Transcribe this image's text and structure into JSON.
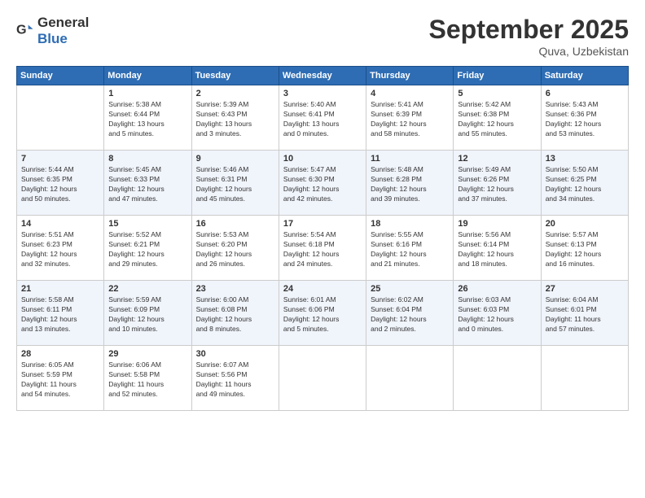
{
  "header": {
    "logo_general": "General",
    "logo_blue": "Blue",
    "month": "September 2025",
    "location": "Quva, Uzbekistan"
  },
  "days_of_week": [
    "Sunday",
    "Monday",
    "Tuesday",
    "Wednesday",
    "Thursday",
    "Friday",
    "Saturday"
  ],
  "weeks": [
    [
      {
        "day": "",
        "text": ""
      },
      {
        "day": "1",
        "text": "Sunrise: 5:38 AM\nSunset: 6:44 PM\nDaylight: 13 hours\nand 5 minutes."
      },
      {
        "day": "2",
        "text": "Sunrise: 5:39 AM\nSunset: 6:43 PM\nDaylight: 13 hours\nand 3 minutes."
      },
      {
        "day": "3",
        "text": "Sunrise: 5:40 AM\nSunset: 6:41 PM\nDaylight: 13 hours\nand 0 minutes."
      },
      {
        "day": "4",
        "text": "Sunrise: 5:41 AM\nSunset: 6:39 PM\nDaylight: 12 hours\nand 58 minutes."
      },
      {
        "day": "5",
        "text": "Sunrise: 5:42 AM\nSunset: 6:38 PM\nDaylight: 12 hours\nand 55 minutes."
      },
      {
        "day": "6",
        "text": "Sunrise: 5:43 AM\nSunset: 6:36 PM\nDaylight: 12 hours\nand 53 minutes."
      }
    ],
    [
      {
        "day": "7",
        "text": "Sunrise: 5:44 AM\nSunset: 6:35 PM\nDaylight: 12 hours\nand 50 minutes."
      },
      {
        "day": "8",
        "text": "Sunrise: 5:45 AM\nSunset: 6:33 PM\nDaylight: 12 hours\nand 47 minutes."
      },
      {
        "day": "9",
        "text": "Sunrise: 5:46 AM\nSunset: 6:31 PM\nDaylight: 12 hours\nand 45 minutes."
      },
      {
        "day": "10",
        "text": "Sunrise: 5:47 AM\nSunset: 6:30 PM\nDaylight: 12 hours\nand 42 minutes."
      },
      {
        "day": "11",
        "text": "Sunrise: 5:48 AM\nSunset: 6:28 PM\nDaylight: 12 hours\nand 39 minutes."
      },
      {
        "day": "12",
        "text": "Sunrise: 5:49 AM\nSunset: 6:26 PM\nDaylight: 12 hours\nand 37 minutes."
      },
      {
        "day": "13",
        "text": "Sunrise: 5:50 AM\nSunset: 6:25 PM\nDaylight: 12 hours\nand 34 minutes."
      }
    ],
    [
      {
        "day": "14",
        "text": "Sunrise: 5:51 AM\nSunset: 6:23 PM\nDaylight: 12 hours\nand 32 minutes."
      },
      {
        "day": "15",
        "text": "Sunrise: 5:52 AM\nSunset: 6:21 PM\nDaylight: 12 hours\nand 29 minutes."
      },
      {
        "day": "16",
        "text": "Sunrise: 5:53 AM\nSunset: 6:20 PM\nDaylight: 12 hours\nand 26 minutes."
      },
      {
        "day": "17",
        "text": "Sunrise: 5:54 AM\nSunset: 6:18 PM\nDaylight: 12 hours\nand 24 minutes."
      },
      {
        "day": "18",
        "text": "Sunrise: 5:55 AM\nSunset: 6:16 PM\nDaylight: 12 hours\nand 21 minutes."
      },
      {
        "day": "19",
        "text": "Sunrise: 5:56 AM\nSunset: 6:14 PM\nDaylight: 12 hours\nand 18 minutes."
      },
      {
        "day": "20",
        "text": "Sunrise: 5:57 AM\nSunset: 6:13 PM\nDaylight: 12 hours\nand 16 minutes."
      }
    ],
    [
      {
        "day": "21",
        "text": "Sunrise: 5:58 AM\nSunset: 6:11 PM\nDaylight: 12 hours\nand 13 minutes."
      },
      {
        "day": "22",
        "text": "Sunrise: 5:59 AM\nSunset: 6:09 PM\nDaylight: 12 hours\nand 10 minutes."
      },
      {
        "day": "23",
        "text": "Sunrise: 6:00 AM\nSunset: 6:08 PM\nDaylight: 12 hours\nand 8 minutes."
      },
      {
        "day": "24",
        "text": "Sunrise: 6:01 AM\nSunset: 6:06 PM\nDaylight: 12 hours\nand 5 minutes."
      },
      {
        "day": "25",
        "text": "Sunrise: 6:02 AM\nSunset: 6:04 PM\nDaylight: 12 hours\nand 2 minutes."
      },
      {
        "day": "26",
        "text": "Sunrise: 6:03 AM\nSunset: 6:03 PM\nDaylight: 12 hours\nand 0 minutes."
      },
      {
        "day": "27",
        "text": "Sunrise: 6:04 AM\nSunset: 6:01 PM\nDaylight: 11 hours\nand 57 minutes."
      }
    ],
    [
      {
        "day": "28",
        "text": "Sunrise: 6:05 AM\nSunset: 5:59 PM\nDaylight: 11 hours\nand 54 minutes."
      },
      {
        "day": "29",
        "text": "Sunrise: 6:06 AM\nSunset: 5:58 PM\nDaylight: 11 hours\nand 52 minutes."
      },
      {
        "day": "30",
        "text": "Sunrise: 6:07 AM\nSunset: 5:56 PM\nDaylight: 11 hours\nand 49 minutes."
      },
      {
        "day": "",
        "text": ""
      },
      {
        "day": "",
        "text": ""
      },
      {
        "day": "",
        "text": ""
      },
      {
        "day": "",
        "text": ""
      }
    ]
  ]
}
